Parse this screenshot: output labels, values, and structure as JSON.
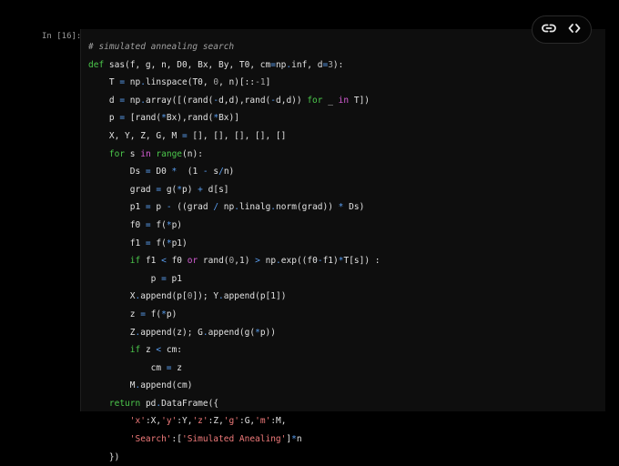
{
  "prompt": "In [16]:",
  "toolbar": {
    "link_icon": "link-icon",
    "code_icon": "code-icon"
  },
  "code_lines": [
    [
      [
        "# simulated annealing search",
        "c"
      ]
    ],
    [
      [
        "def",
        "k"
      ],
      [
        " sas(f, g, n, D0, Bx, By, T0, cm",
        ""
      ],
      [
        "=",
        "o"
      ],
      [
        "np",
        ""
      ],
      [
        ".",
        "o"
      ],
      [
        "inf, d",
        ""
      ],
      [
        "=",
        "o"
      ],
      [
        "3",
        "n"
      ],
      [
        "):",
        ""
      ]
    ],
    [
      [
        "    T ",
        ""
      ],
      [
        "=",
        "o"
      ],
      [
        " np",
        ""
      ],
      [
        ".",
        "o"
      ],
      [
        "linspace(T0, ",
        ""
      ],
      [
        "0",
        "n"
      ],
      [
        ", n)[::",
        ""
      ],
      [
        "-1",
        "n"
      ],
      [
        "]",
        ""
      ]
    ],
    [
      [
        "    d ",
        ""
      ],
      [
        "=",
        "o"
      ],
      [
        " np",
        ""
      ],
      [
        ".",
        "o"
      ],
      [
        "array([(rand(",
        ""
      ],
      [
        "-",
        "o"
      ],
      [
        "d,d),rand(",
        ""
      ],
      [
        "-",
        "o"
      ],
      [
        "d,d)) ",
        ""
      ],
      [
        "for",
        "k"
      ],
      [
        " _ ",
        ""
      ],
      [
        "in",
        "m"
      ],
      [
        " T])",
        ""
      ]
    ],
    [
      [
        "    p ",
        ""
      ],
      [
        "=",
        "o"
      ],
      [
        " [rand(",
        ""
      ],
      [
        "*",
        "o"
      ],
      [
        "Bx),rand(",
        ""
      ],
      [
        "*",
        "o"
      ],
      [
        "Bx)]",
        ""
      ]
    ],
    [
      [
        "    X, Y, Z, G, M ",
        ""
      ],
      [
        "=",
        "o"
      ],
      [
        " [], [], [], [], []",
        ""
      ]
    ],
    [
      [
        "    ",
        ""
      ],
      [
        "for",
        "k"
      ],
      [
        " s ",
        ""
      ],
      [
        "in",
        "m"
      ],
      [
        " ",
        ""
      ],
      [
        "range",
        "k"
      ],
      [
        "(n):",
        ""
      ]
    ],
    [
      [
        "        Ds ",
        ""
      ],
      [
        "=",
        "o"
      ],
      [
        " D0 ",
        ""
      ],
      [
        "*",
        "o"
      ],
      [
        "  (1 ",
        ""
      ],
      [
        "-",
        "o"
      ],
      [
        " s",
        ""
      ],
      [
        "/",
        "o"
      ],
      [
        "n)",
        ""
      ]
    ],
    [
      [
        "        grad ",
        ""
      ],
      [
        "=",
        "o"
      ],
      [
        " g(",
        ""
      ],
      [
        "*",
        "o"
      ],
      [
        "p) ",
        ""
      ],
      [
        "+",
        "o"
      ],
      [
        " d[s]",
        ""
      ]
    ],
    [
      [
        "        p1 ",
        ""
      ],
      [
        "=",
        "o"
      ],
      [
        " p ",
        ""
      ],
      [
        "-",
        "o"
      ],
      [
        " ((grad ",
        ""
      ],
      [
        "/",
        "o"
      ],
      [
        " np",
        ""
      ],
      [
        ".",
        "o"
      ],
      [
        "linalg",
        ""
      ],
      [
        ".",
        "o"
      ],
      [
        "norm(grad)) ",
        ""
      ],
      [
        "*",
        "o"
      ],
      [
        " Ds)",
        ""
      ]
    ],
    [
      [
        "        f0 ",
        ""
      ],
      [
        "=",
        "o"
      ],
      [
        " f(",
        ""
      ],
      [
        "*",
        "o"
      ],
      [
        "p)",
        ""
      ]
    ],
    [
      [
        "        f1 ",
        ""
      ],
      [
        "=",
        "o"
      ],
      [
        " f(",
        ""
      ],
      [
        "*",
        "o"
      ],
      [
        "p1)",
        ""
      ]
    ],
    [
      [
        "        ",
        ""
      ],
      [
        "if",
        "k"
      ],
      [
        " f1 ",
        ""
      ],
      [
        "<",
        "o"
      ],
      [
        " f0 ",
        ""
      ],
      [
        "or",
        "m"
      ],
      [
        " rand(",
        ""
      ],
      [
        "0",
        "n"
      ],
      [
        ",1) ",
        ""
      ],
      [
        ">",
        "o"
      ],
      [
        " np",
        ""
      ],
      [
        ".",
        "o"
      ],
      [
        "exp((f0",
        ""
      ],
      [
        "-",
        "o"
      ],
      [
        "f1)",
        ""
      ],
      [
        "*",
        "o"
      ],
      [
        "T[s]) :",
        ""
      ]
    ],
    [
      [
        "            p ",
        ""
      ],
      [
        "=",
        "o"
      ],
      [
        " p1",
        ""
      ]
    ],
    [
      [
        "        X",
        ""
      ],
      [
        ".",
        "o"
      ],
      [
        "append(p[",
        ""
      ],
      [
        "0",
        "n"
      ],
      [
        "]); Y",
        ""
      ],
      [
        ".",
        "o"
      ],
      [
        "append(p[1])",
        ""
      ]
    ],
    [
      [
        "        z ",
        ""
      ],
      [
        "=",
        "o"
      ],
      [
        " f(",
        ""
      ],
      [
        "*",
        "o"
      ],
      [
        "p)",
        ""
      ]
    ],
    [
      [
        "        Z",
        ""
      ],
      [
        ".",
        "o"
      ],
      [
        "append(z); G",
        ""
      ],
      [
        ".",
        "o"
      ],
      [
        "append(g(",
        ""
      ],
      [
        "*",
        "o"
      ],
      [
        "p))",
        ""
      ]
    ],
    [
      [
        "        ",
        ""
      ],
      [
        "if",
        "k"
      ],
      [
        " z ",
        ""
      ],
      [
        "<",
        "o"
      ],
      [
        " cm:",
        ""
      ]
    ],
    [
      [
        "            cm ",
        ""
      ],
      [
        "=",
        "o"
      ],
      [
        " z",
        ""
      ]
    ],
    [
      [
        "        M",
        ""
      ],
      [
        ".",
        "o"
      ],
      [
        "append(cm)",
        ""
      ]
    ],
    [
      [
        "    ",
        ""
      ],
      [
        "return",
        "k"
      ],
      [
        " pd",
        ""
      ],
      [
        ".",
        "o"
      ],
      [
        "DataFrame({",
        ""
      ]
    ],
    [
      [
        "        ",
        ""
      ],
      [
        "'x'",
        "s"
      ],
      [
        ":X,",
        ""
      ],
      [
        "'y'",
        "s"
      ],
      [
        ":Y,",
        ""
      ],
      [
        "'z'",
        "s"
      ],
      [
        ":Z,",
        ""
      ],
      [
        "'g'",
        "s"
      ],
      [
        ":G,",
        ""
      ],
      [
        "'m'",
        "s"
      ],
      [
        ":M,",
        ""
      ]
    ],
    [
      [
        "        ",
        ""
      ],
      [
        "'Search'",
        "s"
      ],
      [
        ":[",
        ""
      ],
      [
        "'Simulated Anealing'",
        "s"
      ],
      [
        "]",
        ""
      ],
      [
        "*",
        "o"
      ],
      [
        "n",
        ""
      ]
    ],
    [
      [
        "    })",
        ""
      ]
    ]
  ]
}
